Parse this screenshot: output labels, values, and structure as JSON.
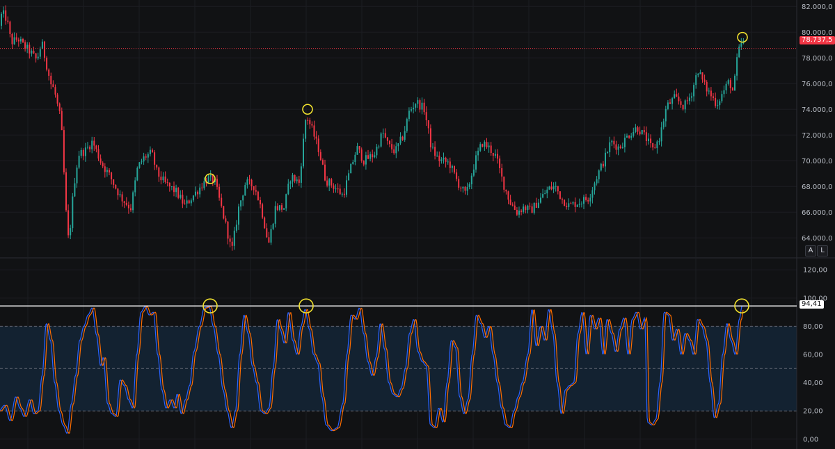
{
  "colors": {
    "background": "#111214",
    "grid": "#1c1d22",
    "bull": "#26a69a",
    "bear": "#f23645",
    "k_line": "#2962ff",
    "d_line": "#ff6d00",
    "band_fill": "#132231",
    "band_line": "#787b86",
    "hline": "#ffffff",
    "marker": "#f2e22e"
  },
  "scale_buttons": {
    "auto": "A",
    "log": "L"
  },
  "chart_data": [
    {
      "type": "candlestick",
      "y_ticks": [
        "64.000,0",
        "66.000,0",
        "68.000,0",
        "70.000,0",
        "72.000,0",
        "74.000,0",
        "76.000,0",
        "78.000,0",
        "80.000,0",
        "82.000,0"
      ],
      "y_tick_values": [
        64000,
        66000,
        68000,
        70000,
        72000,
        74000,
        76000,
        78000,
        80000,
        82000
      ],
      "ylim": [
        62500,
        82500
      ],
      "last_price_label": "78.737,5",
      "last_price": 78737.5,
      "grid": true,
      "anchors": [
        [
          0,
          80500
        ],
        [
          5,
          81500
        ],
        [
          12,
          81000
        ],
        [
          18,
          79200
        ],
        [
          28,
          79500
        ],
        [
          35,
          79000
        ],
        [
          45,
          78500
        ],
        [
          55,
          77800
        ],
        [
          62,
          79200
        ],
        [
          75,
          76000
        ],
        [
          80,
          75500
        ],
        [
          90,
          73000
        ],
        [
          97,
          66000
        ],
        [
          101,
          63500
        ],
        [
          108,
          68000
        ],
        [
          115,
          70500
        ],
        [
          125,
          70800
        ],
        [
          135,
          71500
        ],
        [
          148,
          69800
        ],
        [
          160,
          68800
        ],
        [
          175,
          67200
        ],
        [
          190,
          66300
        ],
        [
          200,
          69500
        ],
        [
          210,
          70300
        ],
        [
          220,
          70600
        ],
        [
          228,
          69000
        ],
        [
          240,
          68200
        ],
        [
          255,
          67600
        ],
        [
          268,
          66500
        ],
        [
          280,
          67300
        ],
        [
          292,
          68100
        ],
        [
          300,
          68600
        ],
        [
          310,
          68500
        ],
        [
          320,
          66400
        ],
        [
          328,
          64700
        ],
        [
          335,
          62900
        ],
        [
          345,
          66300
        ],
        [
          355,
          68300
        ],
        [
          368,
          68000
        ],
        [
          378,
          66200
        ],
        [
          388,
          63500
        ],
        [
          398,
          66400
        ],
        [
          410,
          66300
        ],
        [
          420,
          68800
        ],
        [
          432,
          68300
        ],
        [
          442,
          73600
        ],
        [
          450,
          72500
        ],
        [
          460,
          70900
        ],
        [
          470,
          68500
        ],
        [
          480,
          68100
        ],
        [
          495,
          67300
        ],
        [
          505,
          69200
        ],
        [
          515,
          71000
        ],
        [
          525,
          70000
        ],
        [
          540,
          70500
        ],
        [
          552,
          72200
        ],
        [
          560,
          71200
        ],
        [
          570,
          70700
        ],
        [
          582,
          72000
        ],
        [
          590,
          73800
        ],
        [
          600,
          74600
        ],
        [
          612,
          74000
        ],
        [
          622,
          71000
        ],
        [
          632,
          70100
        ],
        [
          648,
          69800
        ],
        [
          660,
          68300
        ],
        [
          672,
          67300
        ],
        [
          685,
          70000
        ],
        [
          695,
          71400
        ],
        [
          705,
          71000
        ],
        [
          715,
          70300
        ],
        [
          725,
          68300
        ],
        [
          735,
          66800
        ],
        [
          745,
          66000
        ],
        [
          755,
          66400
        ],
        [
          765,
          66100
        ],
        [
          778,
          67000
        ],
        [
          790,
          67800
        ],
        [
          800,
          68000
        ],
        [
          810,
          67000
        ],
        [
          820,
          66500
        ],
        [
          835,
          66800
        ],
        [
          848,
          67100
        ],
        [
          860,
          68800
        ],
        [
          870,
          70000
        ],
        [
          880,
          71500
        ],
        [
          892,
          71000
        ],
        [
          905,
          72000
        ],
        [
          918,
          72600
        ],
        [
          930,
          71800
        ],
        [
          940,
          70800
        ],
        [
          950,
          71800
        ],
        [
          960,
          74200
        ],
        [
          972,
          74900
        ],
        [
          985,
          74200
        ],
        [
          995,
          75100
        ],
        [
          1005,
          77100
        ],
        [
          1015,
          75800
        ],
        [
          1025,
          75000
        ],
        [
          1032,
          74400
        ],
        [
          1042,
          75400
        ],
        [
          1050,
          76200
        ],
        [
          1056,
          75300
        ],
        [
          1062,
          78200
        ],
        [
          1068,
          79200
        ]
      ],
      "x_end": 1068
    },
    {
      "type": "line",
      "y_ticks": [
        "0,00",
        "20,00",
        "40,00",
        "60,00",
        "80,00",
        "100,00",
        "120,00"
      ],
      "y_tick_values": [
        0,
        20,
        40,
        60,
        80,
        100,
        120
      ],
      "ylim": [
        -7,
        128
      ],
      "band": [
        20,
        80
      ],
      "midline": 50,
      "hline_value": 94.41,
      "hline_label": "94,41",
      "grid": true,
      "series": [
        {
          "color_key": "k_line",
          "lead": 1.5,
          "values": [
            [
              0,
              20
            ],
            [
              8,
              24
            ],
            [
              16,
              13
            ],
            [
              24,
              30
            ],
            [
              30,
              22
            ],
            [
              36,
              16
            ],
            [
              44,
              28
            ],
            [
              50,
              18
            ],
            [
              56,
              20
            ],
            [
              62,
              45
            ],
            [
              68,
              82
            ],
            [
              74,
              70
            ],
            [
              80,
              40
            ],
            [
              86,
              20
            ],
            [
              92,
              10
            ],
            [
              98,
              4
            ],
            [
              104,
              25
            ],
            [
              110,
              45
            ],
            [
              116,
              70
            ],
            [
              122,
              80
            ],
            [
              128,
              88
            ],
            [
              134,
              93
            ],
            [
              140,
              74
            ],
            [
              146,
              52
            ],
            [
              150,
              58
            ],
            [
              156,
              25
            ],
            [
              162,
              18
            ],
            [
              168,
              16
            ],
            [
              174,
              42
            ],
            [
              180,
              38
            ],
            [
              186,
              28
            ],
            [
              192,
              22
            ],
            [
              198,
              60
            ],
            [
              204,
              90
            ],
            [
              210,
              94
            ],
            [
              216,
              88
            ],
            [
              222,
              90
            ],
            [
              228,
              60
            ],
            [
              234,
              35
            ],
            [
              240,
              22
            ],
            [
              246,
              28
            ],
            [
              252,
              22
            ],
            [
              256,
              32
            ],
            [
              262,
              18
            ],
            [
              268,
              28
            ],
            [
              274,
              38
            ],
            [
              280,
              62
            ],
            [
              288,
              80
            ],
            [
              295,
              93
            ],
            [
              302,
              94
            ],
            [
              308,
              80
            ],
            [
              315,
              60
            ],
            [
              322,
              35
            ],
            [
              328,
              20
            ],
            [
              334,
              8
            ],
            [
              340,
              20
            ],
            [
              346,
              60
            ],
            [
              352,
              88
            ],
            [
              358,
              75
            ],
            [
              364,
              52
            ],
            [
              370,
              40
            ],
            [
              376,
              20
            ],
            [
              382,
              18
            ],
            [
              388,
              22
            ],
            [
              394,
              50
            ],
            [
              400,
              85
            ],
            [
              404,
              78
            ],
            [
              410,
              68
            ],
            [
              416,
              90
            ],
            [
              422,
              70
            ],
            [
              428,
              60
            ],
            [
              434,
              80
            ],
            [
              440,
              92
            ],
            [
              446,
              78
            ],
            [
              452,
              60
            ],
            [
              458,
              54
            ],
            [
              464,
              30
            ],
            [
              470,
              10
            ],
            [
              478,
              6
            ],
            [
              486,
              8
            ],
            [
              494,
              25
            ],
            [
              500,
              60
            ],
            [
              506,
              88
            ],
            [
              512,
              85
            ],
            [
              518,
              93
            ],
            [
              524,
              75
            ],
            [
              530,
              55
            ],
            [
              536,
              45
            ],
            [
              542,
              58
            ],
            [
              548,
              82
            ],
            [
              554,
              64
            ],
            [
              560,
              40
            ],
            [
              566,
              32
            ],
            [
              572,
              30
            ],
            [
              578,
              36
            ],
            [
              584,
              50
            ],
            [
              590,
              75
            ],
            [
              596,
              85
            ],
            [
              602,
              62
            ],
            [
              608,
              55
            ],
            [
              614,
              52
            ],
            [
              620,
              10
            ],
            [
              626,
              8
            ],
            [
              632,
              22
            ],
            [
              638,
              12
            ],
            [
              644,
              40
            ],
            [
              650,
              70
            ],
            [
              656,
              65
            ],
            [
              662,
              30
            ],
            [
              668,
              18
            ],
            [
              674,
              28
            ],
            [
              680,
              60
            ],
            [
              686,
              88
            ],
            [
              692,
              82
            ],
            [
              698,
              72
            ],
            [
              704,
              80
            ],
            [
              710,
              60
            ],
            [
              716,
              40
            ],
            [
              722,
              22
            ],
            [
              728,
              10
            ],
            [
              734,
              8
            ],
            [
              740,
              20
            ],
            [
              746,
              30
            ],
            [
              752,
              40
            ],
            [
              760,
              60
            ],
            [
              766,
              92
            ],
            [
              772,
              66
            ],
            [
              778,
              80
            ],
            [
              784,
              70
            ],
            [
              790,
              92
            ],
            [
              796,
              75
            ],
            [
              802,
              40
            ],
            [
              808,
              18
            ],
            [
              814,
              35
            ],
            [
              820,
              38
            ],
            [
              826,
              40
            ],
            [
              832,
              75
            ],
            [
              838,
              90
            ],
            [
              844,
              60
            ],
            [
              850,
              88
            ],
            [
              856,
              78
            ],
            [
              862,
              86
            ],
            [
              868,
              60
            ],
            [
              874,
              85
            ],
            [
              880,
              75
            ],
            [
              886,
              62
            ],
            [
              892,
              78
            ],
            [
              898,
              86
            ],
            [
              904,
              60
            ],
            [
              910,
              85
            ],
            [
              916,
              90
            ],
            [
              922,
              78
            ],
            [
              928,
              86
            ],
            [
              932,
              12
            ],
            [
              938,
              10
            ],
            [
              944,
              14
            ],
            [
              950,
              40
            ],
            [
              956,
              90
            ],
            [
              962,
              88
            ],
            [
              968,
              70
            ],
            [
              974,
              78
            ],
            [
              980,
              60
            ],
            [
              986,
              75
            ],
            [
              992,
              70
            ],
            [
              998,
              60
            ],
            [
              1004,
              85
            ],
            [
              1010,
              80
            ],
            [
              1016,
              70
            ],
            [
              1022,
              40
            ],
            [
              1028,
              15
            ],
            [
              1034,
              25
            ],
            [
              1040,
              60
            ],
            [
              1046,
              82
            ],
            [
              1052,
              70
            ],
            [
              1058,
              60
            ],
            [
              1064,
              85
            ],
            [
              1068,
              94.4
            ]
          ]
        },
        {
          "color_key": "d_line",
          "lead": 0,
          "values": "smoothed k"
        }
      ]
    }
  ],
  "markers": [
    {
      "pane": "price",
      "x": 302,
      "value": 68600
    },
    {
      "pane": "price",
      "x": 442,
      "value": 74000
    },
    {
      "pane": "price",
      "x": 1067,
      "value": 79600
    },
    {
      "pane": "stoch",
      "x": 302,
      "value": 94.41
    },
    {
      "pane": "stoch",
      "x": 440,
      "value": 94.41
    },
    {
      "pane": "stoch",
      "x": 1066,
      "value": 94.41
    }
  ]
}
